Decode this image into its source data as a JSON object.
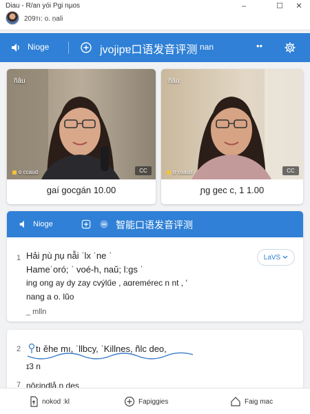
{
  "window": {
    "title": "Diau - R/an yói Pgi nµos",
    "subtitle": "209тı: o.  ṇali",
    "minimize": "–",
    "restore": "☐",
    "close": "✕"
  },
  "header": {
    "left_label": "Nioge",
    "add_icon": "plus-circle-icon",
    "title": "jvojipɐ口语发音评测",
    "right_text": "nan",
    "more": "••",
    "settings_icon": "gear-icon",
    "bg_color": "#2f80d6"
  },
  "videos": [
    {
      "tag": "ñâu",
      "status": "o ccaud",
      "cc": "CC",
      "caption": "gaí gocgán  10.00"
    },
    {
      "tag": "ñâu",
      "status": "o coaud",
      "cc": "CC",
      "caption": "ɲg  gec c,  1 1.00"
    }
  ],
  "panel": {
    "label": "Nioge",
    "title": "智能口语发音评测",
    "lines": [
      "Hải  ɲù  ɲụ  nẫi  ˈlx ˈne  ˈ",
      "Hameˈoró;  ˈ  voé-h,  naŭ;  l:gs  ˈ",
      "ing  ong  ay  dy  zay  cvýlűe ,  aɑremérec n  nt ,  ʻ",
      "nang           a   o.   lũo"
    ],
    "footer": "_ mlln",
    "line_number": "1",
    "lang_button": "LaVS"
  },
  "card2": {
    "number1": "2",
    "phrase": "tı ĕhe mı,  ˈllbcy,  ˈKillnes,  ñlc deo,",
    "number2": "ɪ3  n",
    "number3": "7",
    "next_line": "nȏɛiŋdlå.n des"
  },
  "bottom_nav": [
    {
      "icon": "upload-icon",
      "label": "nokod ːkl"
    },
    {
      "icon": "plus-circle-icon",
      "label": "Fapiggies"
    },
    {
      "icon": "home-icon",
      "label": "Faiɡ  mac"
    }
  ]
}
